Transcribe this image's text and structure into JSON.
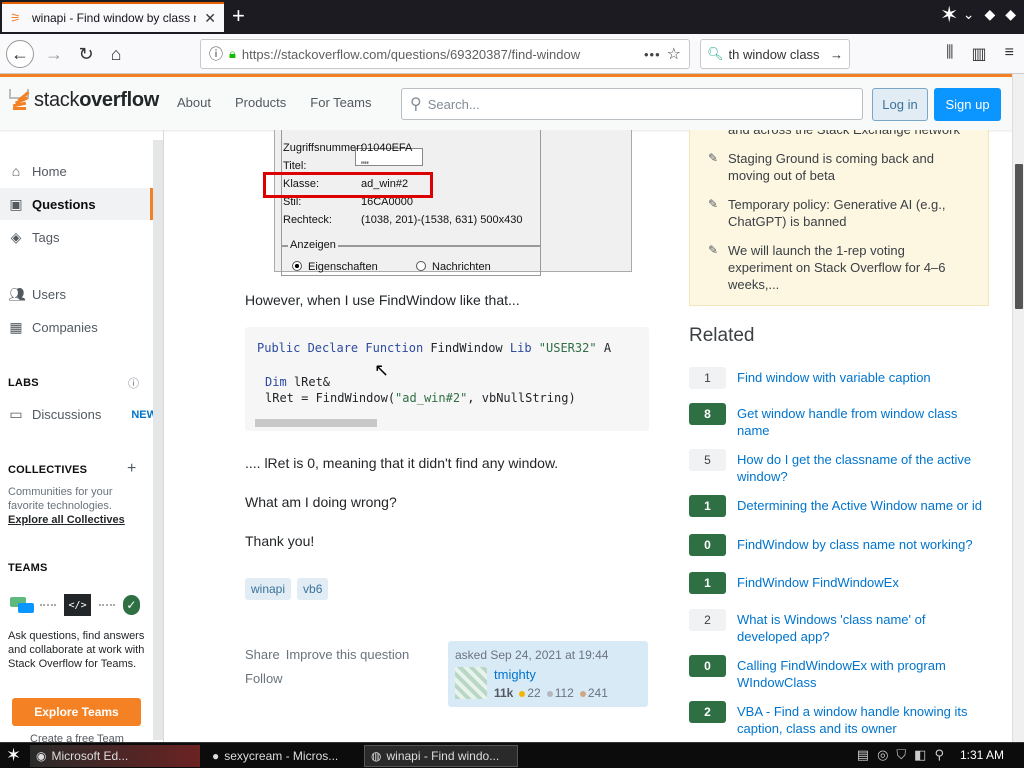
{
  "browser": {
    "tab_title": "winapi - Find window by class nam",
    "url": "https://stackoverflow.com/questions/69320387/find-window",
    "search_query": "th window class"
  },
  "so_header": {
    "logo_plain": "stack",
    "logo_bold": "overflow",
    "nav": [
      "About",
      "Products",
      "For Teams"
    ],
    "search_placeholder": "Search...",
    "login": "Log in",
    "signup": "Sign up"
  },
  "leftnav": {
    "home": "Home",
    "questions": "Questions",
    "tags": "Tags",
    "users": "Users",
    "companies": "Companies",
    "labs": "LABS",
    "discussions": "Discussions",
    "new_badge": "NEW",
    "collectives": "COLLECTIVES",
    "collectives_text": "Communities for your favorite technologies.",
    "explore_collectives": "Explore all Collectives",
    "teams": "TEAMS",
    "teams_text": "Ask questions, find answers and collaborate at work with Stack Overflow for Teams.",
    "explore_teams": "Explore Teams",
    "create_team": "Create a free Team"
  },
  "embedded_screenshot": {
    "rows": [
      {
        "key": "Zugriffsnummer:",
        "value": "01040EFA"
      },
      {
        "key": "Titel:",
        "value": "\"\""
      },
      {
        "key": "Klasse:",
        "value": "ad_win#2"
      },
      {
        "key": "Stil:",
        "value": "16CA0000"
      },
      {
        "key": "Rechteck:",
        "value": "(1038, 201)-(1538, 631) 500x430"
      }
    ],
    "group_label": "Anzeigen",
    "radio1": "Eigenschaften",
    "radio2": "Nachrichten"
  },
  "post": {
    "p1": "However, when I use FindWindow like that...",
    "code_line1_kw": "Public Declare Function",
    "code_line1_name": " FindWindow ",
    "code_line1_lib": "Lib",
    "code_line1_str": " \"USER32\"",
    "code_line1_tail": " A",
    "code_line2_kw": "Dim",
    "code_line2_rest": " lRet&",
    "code_line3_a": "lRet = FindWindow(",
    "code_line3_str": "\"ad_win#2\"",
    "code_line3_b": ", vbNullString)",
    "p2": ".... lRet is 0, meaning that it didn't find any window.",
    "p3": "What am I doing wrong?",
    "p4": "Thank you!",
    "tags": [
      "winapi",
      "vb6"
    ],
    "share": "Share",
    "improve": "Improve this question",
    "follow": "Follow",
    "asked": "asked Sep 24, 2021 at 19:44",
    "user": "tmighty",
    "rep": "11k",
    "gold": "22",
    "silver": "112",
    "bronze": "241"
  },
  "blog": {
    "items": [
      "and across the Stack Exchange network",
      "Staging Ground is coming back and moving out of beta",
      "Temporary policy: Generative AI (e.g., ChatGPT) is banned",
      "We will launch the 1-rep voting experiment on Stack Overflow for 4–6 weeks,..."
    ]
  },
  "related": {
    "heading": "Related",
    "items": [
      {
        "score": "1",
        "title": "Find window with variable caption",
        "accepted": false
      },
      {
        "score": "8",
        "title": "Get window handle from window class name",
        "accepted": true
      },
      {
        "score": "5",
        "title": "How do I get the classname of the active window?",
        "accepted": false
      },
      {
        "score": "1",
        "title": "Determining the Active Window name or id",
        "accepted": true
      },
      {
        "score": "0",
        "title": "FindWindow by class name not working?",
        "accepted": true
      },
      {
        "score": "1",
        "title": "FindWindow FindWindowEx",
        "accepted": true
      },
      {
        "score": "2",
        "title": "What is Windows 'class name' of developed app?",
        "accepted": false
      },
      {
        "score": "0",
        "title": "Calling FindWindowEx with program WIndowClass",
        "accepted": true
      },
      {
        "score": "2",
        "title": "VBA - Find a window handle knowing its caption, class and its owner",
        "accepted": true
      }
    ]
  },
  "taskbar": {
    "item1": "Microsoft Ed...",
    "item2": "sexycream - Micros...",
    "item3": "winapi - Find windo...",
    "time": "1:31 AM"
  }
}
